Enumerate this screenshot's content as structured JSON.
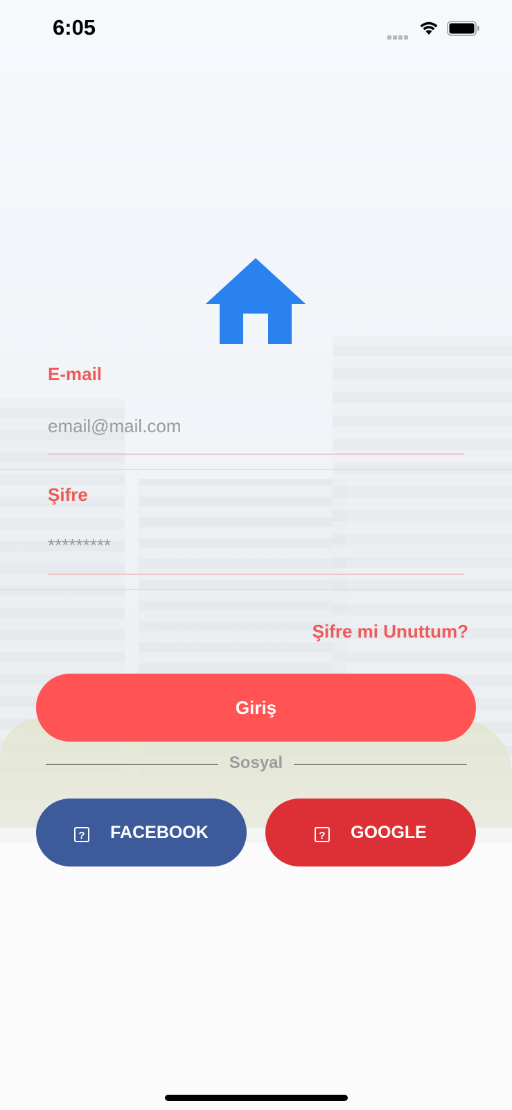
{
  "status_bar": {
    "time": "6:05"
  },
  "logo": {
    "icon": "home-icon",
    "color": "#2a82f0"
  },
  "form": {
    "email": {
      "label": "E-mail",
      "placeholder": "email@mail.com",
      "value": ""
    },
    "password": {
      "label": "Şifre",
      "placeholder": "*********",
      "value": ""
    },
    "forgot_label": "Şifre mi Unuttum?",
    "login_label": "Giriş"
  },
  "social": {
    "divider_label": "Sosyal",
    "facebook_label": "FACEBOOK",
    "google_label": "GOOGLE",
    "facebook_icon": "question-mark-icon",
    "google_icon": "question-mark-icon"
  },
  "colors": {
    "accent": "#ee5a5a",
    "login_button": "#ff5354",
    "facebook": "#3d5b9b",
    "google": "#dc3036",
    "logo": "#2a82f0"
  }
}
